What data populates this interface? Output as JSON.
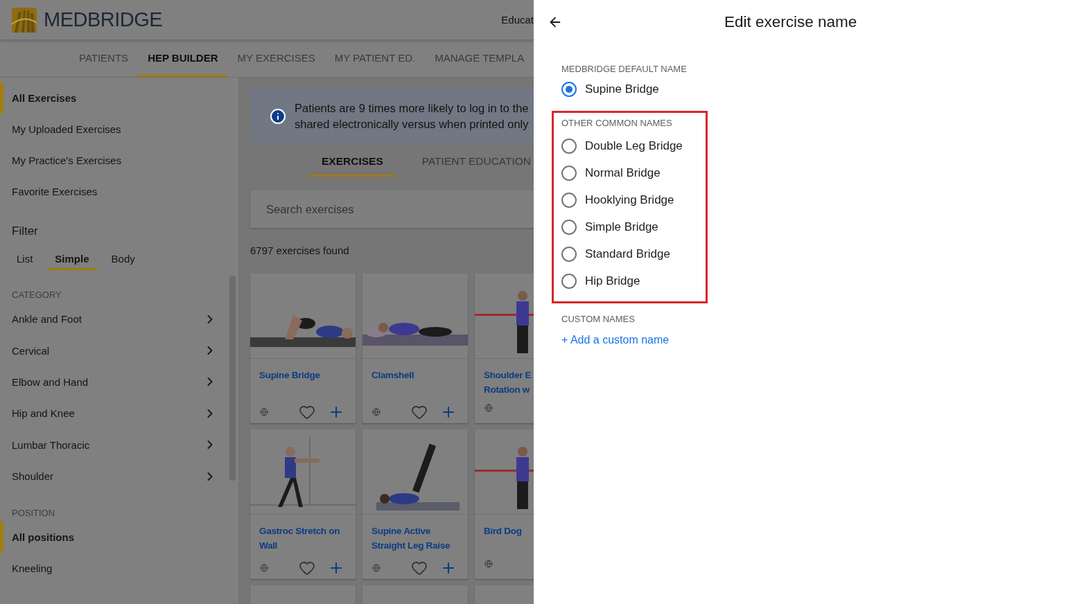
{
  "header": {
    "logo_text": "MEDBRIDGE",
    "right_text": "Educat"
  },
  "nav_tabs": [
    {
      "label": "PATIENTS",
      "selected": false
    },
    {
      "label": "HEP BUILDER",
      "selected": true
    },
    {
      "label": "MY EXERCISES",
      "selected": false
    },
    {
      "label": "MY PATIENT ED.",
      "selected": false
    },
    {
      "label": "MANAGE TEMPLA",
      "selected": false
    }
  ],
  "sidebar": {
    "library_items": [
      {
        "label": "All Exercises",
        "selected": true
      },
      {
        "label": "My Uploaded Exercises",
        "selected": false
      },
      {
        "label": "My Practice's Exercises",
        "selected": false
      },
      {
        "label": "Favorite Exercises",
        "selected": false
      }
    ],
    "filter_title": "Filter",
    "filter_tabs": [
      {
        "label": "List",
        "selected": false
      },
      {
        "label": "Simple",
        "selected": true
      },
      {
        "label": "Body",
        "selected": false
      }
    ],
    "category_heading": "CATEGORY",
    "categories": [
      {
        "label": "Ankle and Foot"
      },
      {
        "label": "Cervical"
      },
      {
        "label": "Elbow and Hand"
      },
      {
        "label": "Hip and Knee"
      },
      {
        "label": "Lumbar Thoracic"
      },
      {
        "label": "Shoulder"
      }
    ],
    "position_heading": "POSITION",
    "positions": [
      {
        "label": "All positions",
        "selected": true
      },
      {
        "label": "Kneeling",
        "selected": false
      }
    ]
  },
  "banner": {
    "lines": [
      "Patients are 9 times more likely to log in to the",
      "shared electronically versus when printed only"
    ]
  },
  "content_tabs": [
    {
      "label": "EXERCISES",
      "selected": true
    },
    {
      "label": "PATIENT EDUCATION",
      "selected": false
    }
  ],
  "search": {
    "placeholder": "Search exercises"
  },
  "result_count": "6797 exercises found",
  "exercise_cards": [
    {
      "kind": "exercise",
      "title_lines": [
        "Supine Bridge"
      ]
    },
    {
      "kind": "exercise",
      "title_lines": [
        "Clamshell"
      ]
    },
    {
      "kind": "partial",
      "title_lines": [
        "Shoulder E",
        "Rotation w"
      ]
    },
    {
      "kind": "exercise",
      "title_lines": [
        "Gastroc Stretch on",
        "Wall"
      ]
    },
    {
      "kind": "exercise",
      "title_lines": [
        "Supine Active",
        "Straight Leg Raise"
      ]
    },
    {
      "kind": "partial",
      "title_lines": [
        "Bird Dog"
      ]
    },
    {
      "kind": "blank"
    },
    {
      "kind": "blank"
    },
    {
      "kind": "blank"
    }
  ],
  "drawer": {
    "title": "Edit exercise name",
    "sections": [
      {
        "kind": "radio",
        "heading": "MEDBRIDGE DEFAULT NAME",
        "highlighted": false,
        "options": [
          {
            "label": "Supine Bridge",
            "selected": true
          }
        ]
      },
      {
        "kind": "radio",
        "heading": "OTHER COMMON NAMES",
        "highlighted": true,
        "options": [
          {
            "label": "Double Leg Bridge",
            "selected": false
          },
          {
            "label": "Normal Bridge",
            "selected": false
          },
          {
            "label": "Hooklying Bridge",
            "selected": false
          },
          {
            "label": "Simple Bridge",
            "selected": false
          },
          {
            "label": "Standard Bridge",
            "selected": false
          },
          {
            "label": "Hip Bridge",
            "selected": false
          }
        ]
      },
      {
        "kind": "link",
        "heading": "CUSTOM NAMES",
        "highlighted": false,
        "link": "+ Add a custom name"
      }
    ]
  }
}
